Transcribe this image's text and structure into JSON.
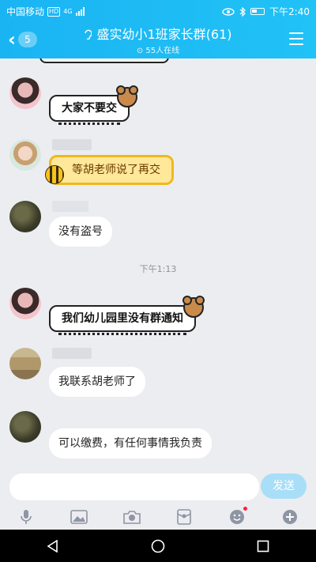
{
  "status_bar": {
    "carrier": "中国移动",
    "network_badge": "HD",
    "network_type": "4G",
    "time": "下午2:40"
  },
  "header": {
    "back_count": "5",
    "title": "盛实幼小1班家长群(61)",
    "online": "55人在线"
  },
  "messages": [
    {
      "type": "comic",
      "text": "大家不要交"
    },
    {
      "type": "honey",
      "text": "等胡老师说了再交"
    },
    {
      "type": "text",
      "text": "没有盗号"
    },
    {
      "type": "time",
      "text": "下午1:13"
    },
    {
      "type": "comic",
      "text": "我们幼儿园里没有群通知"
    },
    {
      "type": "text",
      "text": "我联系胡老师了"
    },
    {
      "type": "text",
      "text": "可以缴费，有任何事情我负责"
    }
  ],
  "input": {
    "value": "",
    "send_label": "发送"
  },
  "toolbar_icons": [
    "microphone-icon",
    "image-icon",
    "camera-icon",
    "red-packet-icon",
    "emoji-icon",
    "plus-icon"
  ],
  "colors": {
    "accent": "#1ab4f3",
    "chat_bg": "#ecedf1",
    "send_disabled": "#a8def7"
  }
}
